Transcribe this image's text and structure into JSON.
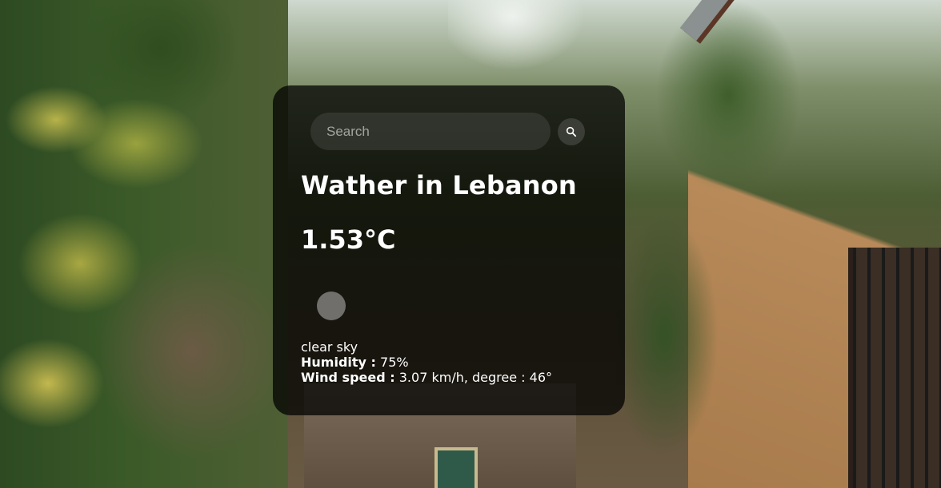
{
  "search": {
    "placeholder": "Search",
    "icon": "search-icon"
  },
  "weather": {
    "title": "Wather in Lebanon",
    "temperature": "1.53°C",
    "icon": "weather-icon",
    "description": "clear sky",
    "humidity_label": "Humidity :",
    "humidity_value": "75%",
    "wind_label": "Wind speed :",
    "wind_value": "3.07 km/h, degree : 46°"
  },
  "colors": {
    "card_background": "#000000",
    "text": "#ffffff"
  }
}
